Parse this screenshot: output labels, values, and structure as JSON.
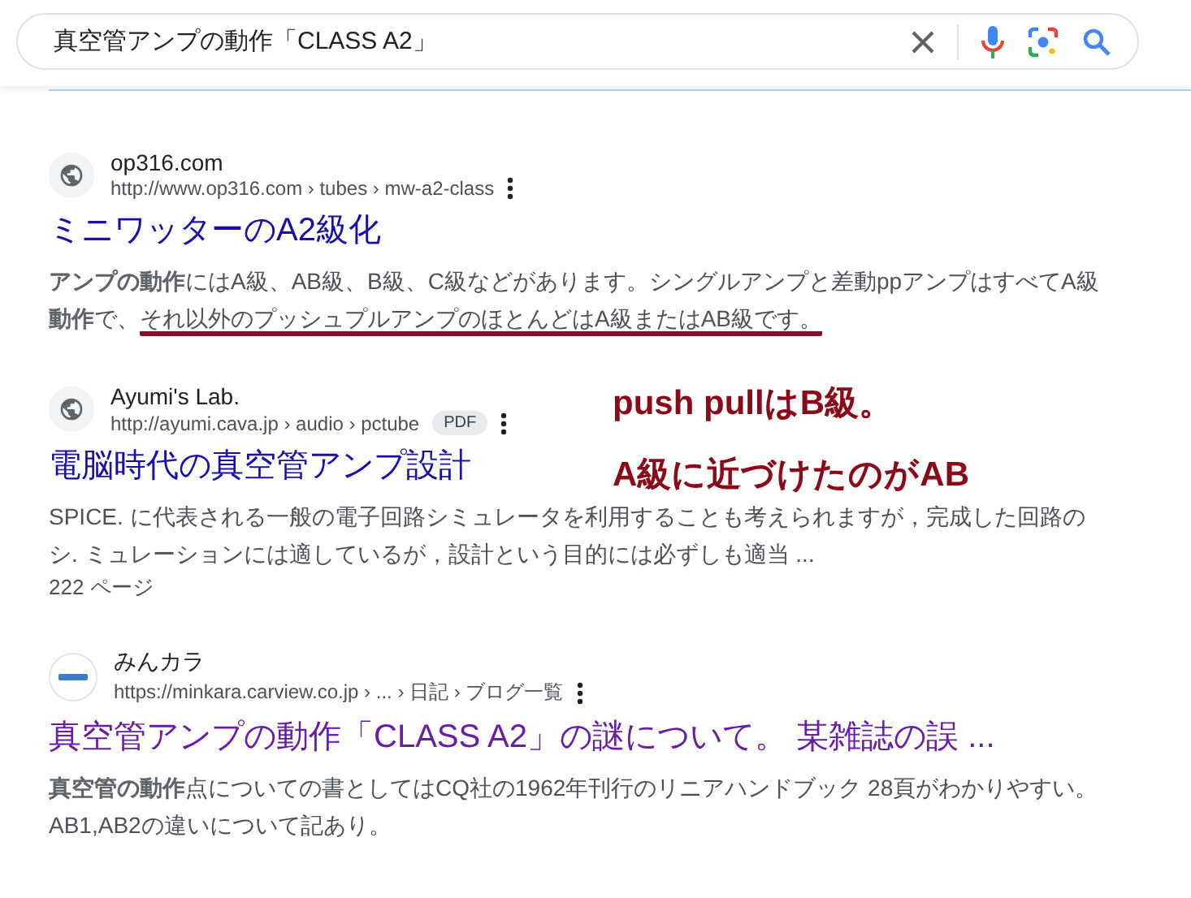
{
  "search": {
    "value": "真空管アンプの動作「CLASS A2」"
  },
  "results": [
    {
      "site": "op316.com",
      "url": "http://www.op316.com › tubes › mw-a2-class",
      "kind": "globe",
      "title": "ミニワッターのA2級化",
      "visited": false,
      "snippet": "**アンプの動作**にはA級、AB級、B級、C級などがあります。シングルアンプと差動ppアンプはすべてA級**動作**で、",
      "underlined": "それ以外のプッシュプルアンプのほとんどはA級またはAB級です。"
    },
    {
      "site": "Ayumi's Lab.",
      "url": "http://ayumi.cava.jp › audio › pctube",
      "badge": "PDF",
      "kind": "globe",
      "title": "電脳時代の真空管アンプ設計",
      "visited": false,
      "snippet": "SPICE. に代表される一般の電子回路シミュレータを利用することも考えられますが，完成した回路のシ. ミュレーションには適しているが，設計という目的には必ずしも適当 ...",
      "pages": "222 ページ"
    },
    {
      "site": "みんカラ",
      "url": "https://minkara.carview.co.jp › ... › 日記 › ブログ一覧",
      "kind": "logo",
      "title": "真空管アンプの動作「CLASS A2」の謎について。 某雑誌の誤 ...",
      "visited": true,
      "snippet": "**真空管の動作**点についての書としてはCQ社の1962年刊行のリニアハンドブック 28頁がわかりやすい。AB1,AB2の違いについて記あり。"
    }
  ],
  "annotations": [
    "push pullはB級。",
    "A級に近づけたのがAB"
  ]
}
